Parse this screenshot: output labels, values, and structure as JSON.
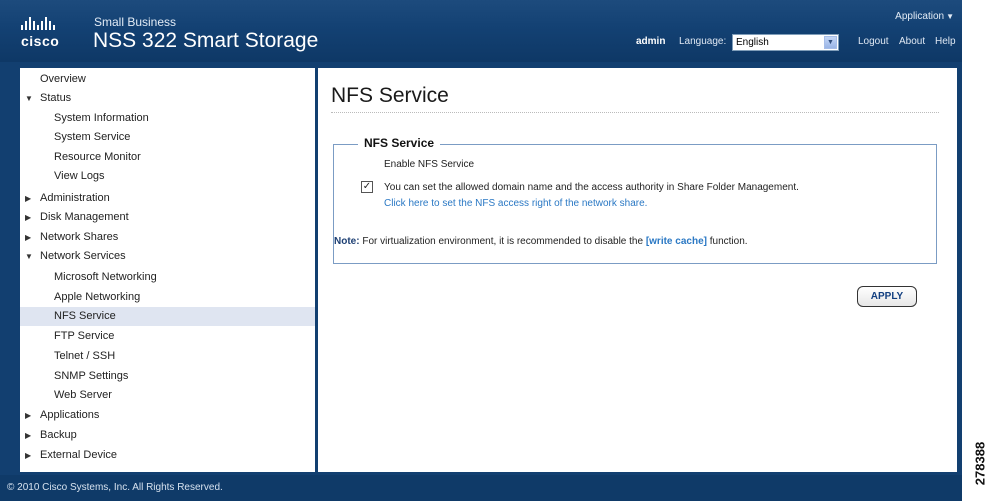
{
  "header": {
    "brand": "cisco",
    "subtitle": "Small Business",
    "product": "NSS 322 Smart Storage",
    "app_menu": "Application",
    "user": "admin",
    "language_label": "Language:",
    "language_value": "English",
    "logout": "Logout",
    "about": "About",
    "help": "Help"
  },
  "sidebar": {
    "items": [
      {
        "label": "Overview"
      },
      {
        "label": "Status"
      },
      {
        "label": "System Information"
      },
      {
        "label": "System Service"
      },
      {
        "label": "Resource Monitor"
      },
      {
        "label": "View Logs"
      },
      {
        "label": "Administration"
      },
      {
        "label": "Disk Management"
      },
      {
        "label": "Network Shares"
      },
      {
        "label": "Network Services"
      },
      {
        "label": "Microsoft Networking"
      },
      {
        "label": "Apple Networking"
      },
      {
        "label": "NFS Service"
      },
      {
        "label": "FTP Service"
      },
      {
        "label": "Telnet / SSH"
      },
      {
        "label": "SNMP Settings"
      },
      {
        "label": "Web Server"
      },
      {
        "label": "Applications"
      },
      {
        "label": "Backup"
      },
      {
        "label": "External Device"
      }
    ]
  },
  "main": {
    "title": "NFS Service",
    "section_title": "NFS Service",
    "enable_label": "Enable NFS Service",
    "checkbox_checked": true,
    "description": "You can set the allowed domain name and the access authority in Share Folder Management.",
    "link_text": "Click here to set the NFS access right of the network share.",
    "note_label": "Note:",
    "note_text_1": "For virtualization environment, it is recommended to disable the",
    "note_link": "[write cache]",
    "note_text_2": "function.",
    "apply_label": "APPLY"
  },
  "footer": {
    "copyright": "© 2010 Cisco Systems, Inc. All Rights Reserved."
  },
  "figure_number": "278388",
  "colors": {
    "header_blue": "#134173",
    "link_blue": "#2a78c4",
    "active_row": "#dfe5f1"
  }
}
